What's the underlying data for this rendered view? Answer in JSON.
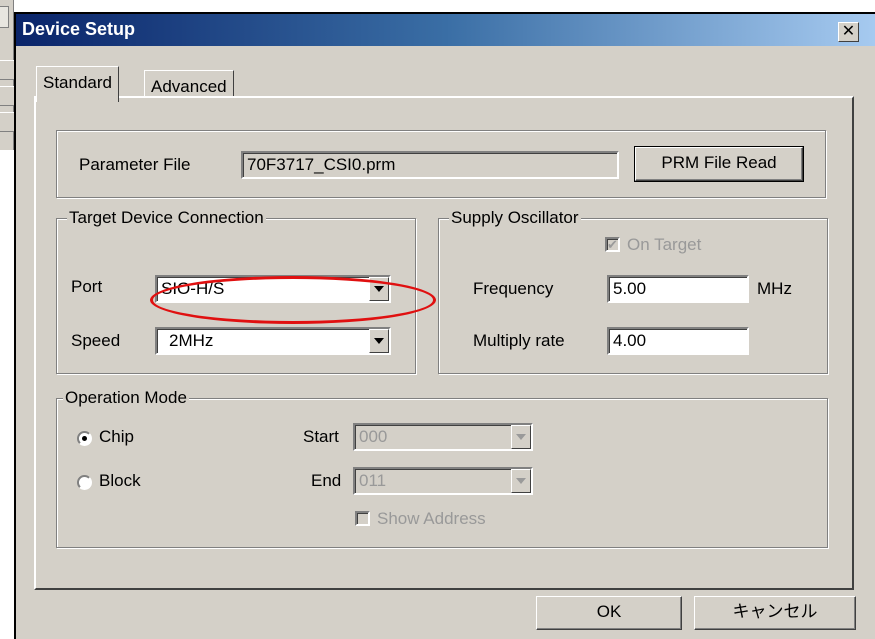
{
  "dialog": {
    "title": "Device Setup",
    "close_glyph": "✕"
  },
  "tabs": [
    {
      "label": "Standard",
      "active": true
    },
    {
      "label": "Advanced",
      "active": false
    }
  ],
  "parameter_file": {
    "label": "Parameter File",
    "value": "70F3717_CSI0.prm",
    "button": "PRM File Read"
  },
  "target_connection": {
    "legend": "Target Device Connection",
    "port_label": "Port",
    "port_value": "SIO-H/S",
    "speed_label": "Speed",
    "speed_value": "2MHz"
  },
  "supply_oscillator": {
    "legend": "Supply Oscillator",
    "on_target_label": "On Target",
    "on_target_checked": true,
    "frequency_label": "Frequency",
    "frequency_value": "5.00",
    "frequency_unit": "MHz",
    "multiply_label": "Multiply rate",
    "multiply_value": "4.00"
  },
  "operation_mode": {
    "legend": "Operation Mode",
    "chip_label": "Chip",
    "chip_selected": true,
    "block_label": "Block",
    "start_label": "Start",
    "start_value": "000",
    "end_label": "End",
    "end_value": "011",
    "show_address_label": "Show Address"
  },
  "footer": {
    "ok_label": "OK",
    "cancel_label": "キャンセル"
  },
  "annotation": {
    "highlight_color": "#e01010"
  }
}
